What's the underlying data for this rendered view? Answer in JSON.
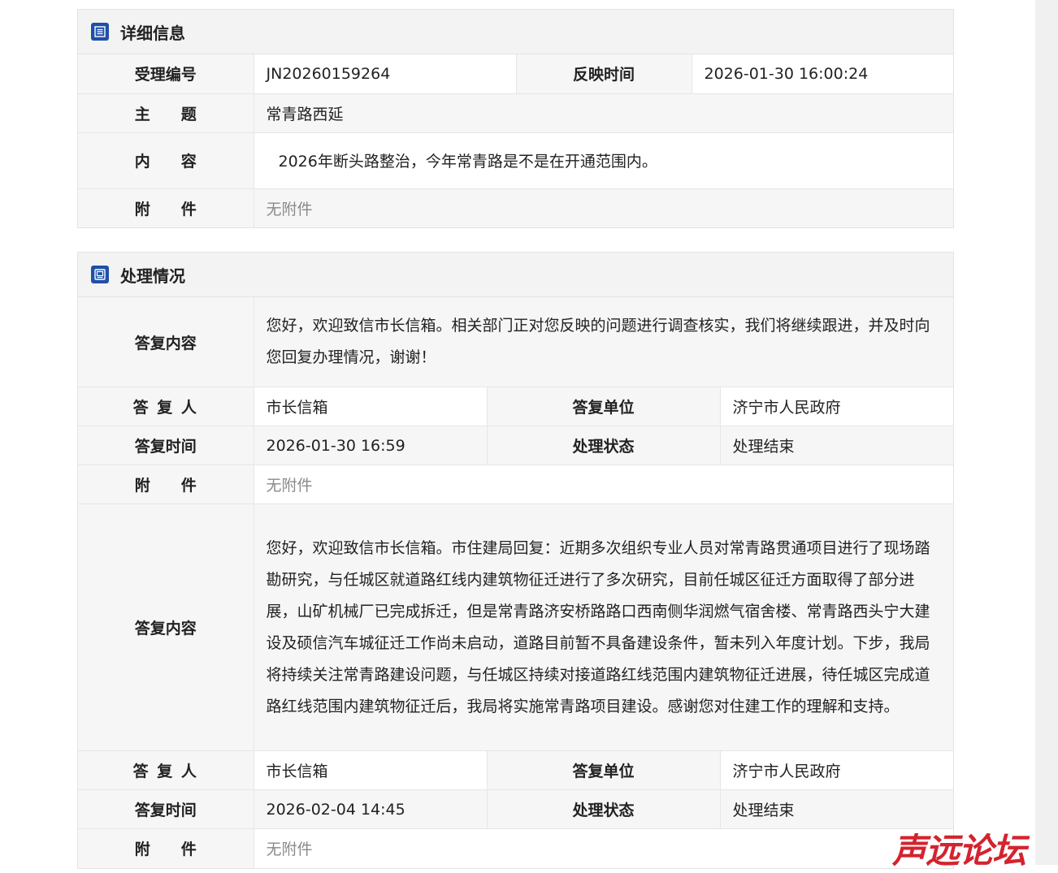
{
  "detail": {
    "title": "详细信息",
    "rows": {
      "accept_no_label": "受理编号",
      "accept_no_value": "JN20260159264",
      "report_time_label": "反映时间",
      "report_time_value": "2026-01-30 16:00:24",
      "subject_label": "主　　题",
      "subject_value": "常青路西延",
      "content_label": "内　　容",
      "content_value": "2026年断头路整治，今年常青路是不是在开通范围内。",
      "attach_label": "附　　件",
      "attach_value": "无附件"
    }
  },
  "handling": {
    "title": "处理情况",
    "replies": [
      {
        "content_label": "答复内容",
        "content": "您好，欢迎致信市长信箱。相关部门正对您反映的问题进行调查核实，我们将继续跟进，并及时向您回复办理情况，谢谢！",
        "replier_label": "答 复 人",
        "replier": "市长信箱",
        "unit_label": "答复单位",
        "unit": "济宁市人民政府",
        "time_label": "答复时间",
        "time": "2026-01-30 16:59",
        "status_label": "处理状态",
        "status": "处理结束",
        "attach_label": "附　　件",
        "attach": "无附件"
      },
      {
        "content_label": "答复内容",
        "content": "您好，欢迎致信市长信箱。市住建局回复：近期多次组织专业人员对常青路贯通项目进行了现场踏勘研究，与任城区就道路红线内建筑物征迁进行了多次研究，目前任城区征迁方面取得了部分进展，山矿机械厂已完成拆迁，但是常青路济安桥路路口西南侧华润燃气宿舍楼、常青路西头宁大建设及硕信汽车城征迁工作尚未启动，道路目前暂不具备建设条件，暂未列入年度计划。下步，我局将持续关注常青路建设问题，与任城区持续对接道路红线范围内建筑物征迁进展，待任城区完成道路红线范围内建筑物征迁后，我局将实施常青路项目建设。感谢您对住建工作的理解和支持。",
        "replier_label": "答 复 人",
        "replier": "市长信箱",
        "unit_label": "答复单位",
        "unit": "济宁市人民政府",
        "time_label": "答复时间",
        "time": "2026-02-04 14:45",
        "status_label": "处理状态",
        "status": "处理结束",
        "attach_label": "附　　件",
        "attach": "无附件"
      }
    ]
  },
  "watermark": {
    "text": "声远论坛",
    "color": "#d4232e"
  },
  "icons": {
    "detail": "list-document-icon",
    "handling": "reply-document-icon"
  }
}
